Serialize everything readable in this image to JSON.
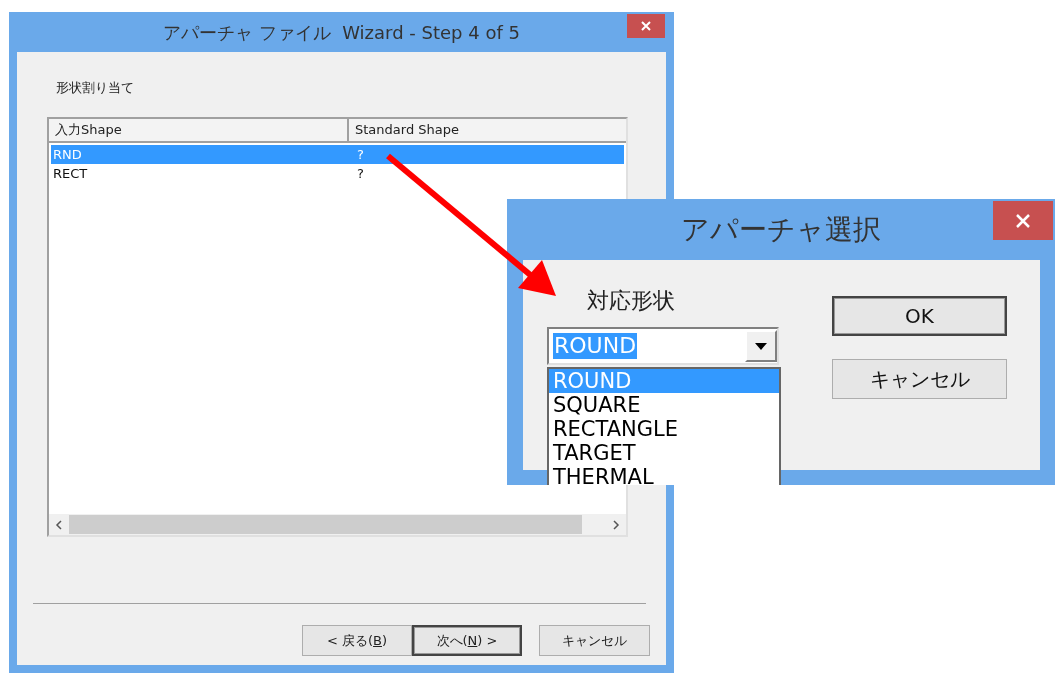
{
  "wizard": {
    "title": "アパーチャ ファイル  Wizard - Step 4 of 5",
    "section_label": "形状割り当て",
    "table": {
      "columns": [
        "入力Shape",
        "Standard Shape"
      ],
      "rows": [
        {
          "cells": [
            "RND",
            "?"
          ],
          "selected": true
        },
        {
          "cells": [
            "RECT",
            "?"
          ],
          "selected": false
        }
      ]
    },
    "buttons": [
      {
        "before": "< 戻る(",
        "access_key": "B",
        "after": ")",
        "default": false
      },
      {
        "before": "次へ(",
        "access_key": "N",
        "after": ") >",
        "default": true
      },
      {
        "before": "キャンセル",
        "default": false
      }
    ]
  },
  "dialog": {
    "title": "アパーチャ選択",
    "field_label": "対応形状",
    "combo": {
      "value": "ROUND",
      "text_selected": true
    },
    "options": [
      {
        "label": "ROUND",
        "selected": true
      },
      {
        "label": "SQUARE",
        "selected": false
      },
      {
        "label": "RECTANGLE",
        "selected": false
      },
      {
        "label": "TARGET",
        "selected": false
      },
      {
        "label": "THERMAL",
        "selected": false
      }
    ],
    "buttons": [
      {
        "before": "OK",
        "default": true
      },
      {
        "before": "キャンセル",
        "default": false
      }
    ]
  }
}
